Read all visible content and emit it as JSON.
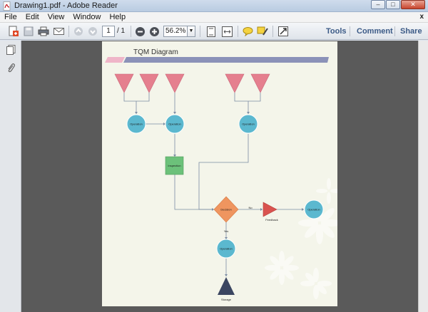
{
  "window": {
    "title": "Drawing1.pdf - Adobe Reader"
  },
  "menu": {
    "items": [
      "File",
      "Edit",
      "View",
      "Window",
      "Help"
    ],
    "close_label": "x"
  },
  "toolbar": {
    "page_current": "1",
    "page_total": "/ 1",
    "zoom": "56.2%",
    "tools_label": "Tools",
    "comment_label": "Comment",
    "share_label": "Share"
  },
  "icons": [
    "create-pdf-icon",
    "save-icon",
    "print-icon",
    "email-icon",
    "previous-page-icon",
    "next-page-icon",
    "zoom-out-icon",
    "zoom-in-icon",
    "fit-page-icon",
    "fit-width-icon",
    "comment-icon",
    "highlight-icon",
    "full-screen-icon",
    "pages-panel-icon",
    "attachments-icon"
  ],
  "colors": {
    "triangle_pink": "#e57f8e",
    "operation_blue": "#5bb8cf",
    "inspection_green": "#6cc17a",
    "decision_orange": "#ef955f",
    "feedback_red": "#d9534f",
    "storage_navy": "#3b4661",
    "title_band": "#8b92b8"
  },
  "diagram": {
    "title": "TQM Diagram",
    "labels": {
      "op1": "Operation",
      "op2": "Operation",
      "op3": "Operation",
      "op4": "Operation",
      "op5": "Operation",
      "inspection": "Inspection",
      "decision": "Decision",
      "no": "No",
      "yes": "Yes",
      "feedback": "Feedback",
      "storage": "Storage"
    }
  }
}
